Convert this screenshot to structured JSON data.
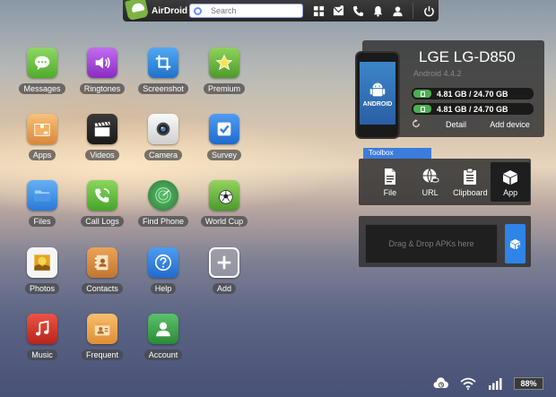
{
  "topbar": {
    "brand": "AirDroid",
    "search_placeholder": "Search",
    "icons": [
      "grid-icon",
      "message-icon",
      "phone-icon",
      "bell-icon",
      "user-icon",
      "power-icon"
    ]
  },
  "apps": [
    {
      "label": "Messages",
      "icon": "messages-icon",
      "color": "#6ac34a"
    },
    {
      "label": "Ringtones",
      "icon": "speaker-icon",
      "color": "#9c3fd1"
    },
    {
      "label": "Screenshot",
      "icon": "crop-icon",
      "color": "#2f8ee0"
    },
    {
      "label": "Premium",
      "icon": "star-icon",
      "color": "#6db33f"
    },
    {
      "label": "Apps",
      "icon": "box-icon",
      "color": "#e8a14a"
    },
    {
      "label": "Videos",
      "icon": "clapper-icon",
      "color": "#2b2b2b"
    },
    {
      "label": "Camera",
      "icon": "camera-icon",
      "color": "#e9e9e9"
    },
    {
      "label": "Survey",
      "icon": "checkbox-icon",
      "color": "#2f7fe0"
    },
    {
      "label": "Files",
      "icon": "folder-icon",
      "color": "#3b8fe6"
    },
    {
      "label": "Call Logs",
      "icon": "phone-call-icon",
      "color": "#5fbf3c"
    },
    {
      "label": "Find Phone",
      "icon": "radar-icon",
      "color": "#3d9b49"
    },
    {
      "label": "World Cup",
      "icon": "soccer-ball-icon",
      "color": "#63b93c"
    },
    {
      "label": "Photos",
      "icon": "photo-icon",
      "color": "#f2f2f2"
    },
    {
      "label": "Contacts",
      "icon": "contacts-book-icon",
      "color": "#d88c3b"
    },
    {
      "label": "Help",
      "icon": "help-icon",
      "color": "#2f86e0"
    },
    {
      "label": "Add",
      "icon": "plus-icon",
      "color": "#9a9a9a"
    },
    {
      "label": "Music",
      "icon": "music-note-icon",
      "color": "#d8362b"
    },
    {
      "label": "Frequent",
      "icon": "frequent-contact-icon",
      "color": "#f0a347"
    },
    {
      "label": "Account",
      "icon": "account-icon",
      "color": "#3cab4a"
    }
  ],
  "device": {
    "name": "LGE LG-D850",
    "os": "Android 4.4.2",
    "phone_label": "ANDROID",
    "storage": [
      "4.81 GB / 24.70 GB",
      "4.81 GB / 24.70 GB"
    ],
    "detail_label": "Detail",
    "add_device_label": "Add device"
  },
  "toolbox": {
    "tab": "Toolbox",
    "tools": [
      {
        "label": "File",
        "icon": "file-icon"
      },
      {
        "label": "URL",
        "icon": "globe-link-icon"
      },
      {
        "label": "Clipboard",
        "icon": "clipboard-icon"
      },
      {
        "label": "App",
        "icon": "app-box-icon"
      }
    ]
  },
  "dropzone": {
    "text": "Drag & Drop APKs here"
  },
  "status": {
    "battery": "88%"
  }
}
